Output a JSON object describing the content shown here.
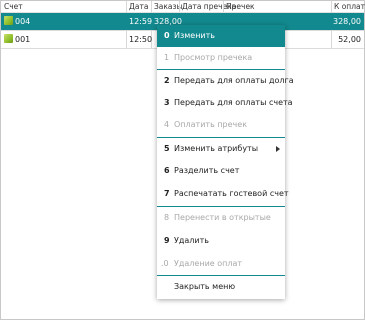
{
  "table": {
    "columns": [
      "Счет",
      "Дата",
      "Заказы",
      "Дата пречека",
      "Пречек",
      "К оплате"
    ],
    "rows": [
      {
        "account": "004",
        "date": "12:59",
        "orders": "328,00",
        "to_pay": "328,00",
        "selected": true
      },
      {
        "account": "001",
        "date": "12:50",
        "orders": "",
        "to_pay": "52,00",
        "selected": false
      }
    ]
  },
  "menu": {
    "items": [
      {
        "key": "0",
        "label": "Изменить",
        "state": "active"
      },
      {
        "key": "1",
        "label": "Просмотр пречека",
        "state": "disabled"
      },
      {
        "key": "2",
        "label": "Передать для оплаты долга",
        "state": "enabled"
      },
      {
        "key": "3",
        "label": "Передать для оплаты счета",
        "state": "enabled"
      },
      {
        "key": "4",
        "label": "Оплатить пречек",
        "state": "disabled"
      },
      {
        "key": "5",
        "label": "Изменить атрибуты",
        "state": "enabled"
      },
      {
        "key": "6",
        "label": "Разделить счет",
        "state": "enabled"
      },
      {
        "key": "7",
        "label": "Распечатать гостевой счет",
        "state": "enabled"
      },
      {
        "key": "8",
        "label": "Перенести в открытые",
        "state": "disabled"
      },
      {
        "key": "9",
        "label": "Удалить",
        "state": "enabled"
      },
      {
        "key": ".0",
        "label": "Удаление оплат",
        "state": "disabled"
      },
      {
        "key": "",
        "label": "Закрыть меню",
        "state": "enabled"
      }
    ]
  },
  "colors": {
    "accent": "#12898e"
  }
}
